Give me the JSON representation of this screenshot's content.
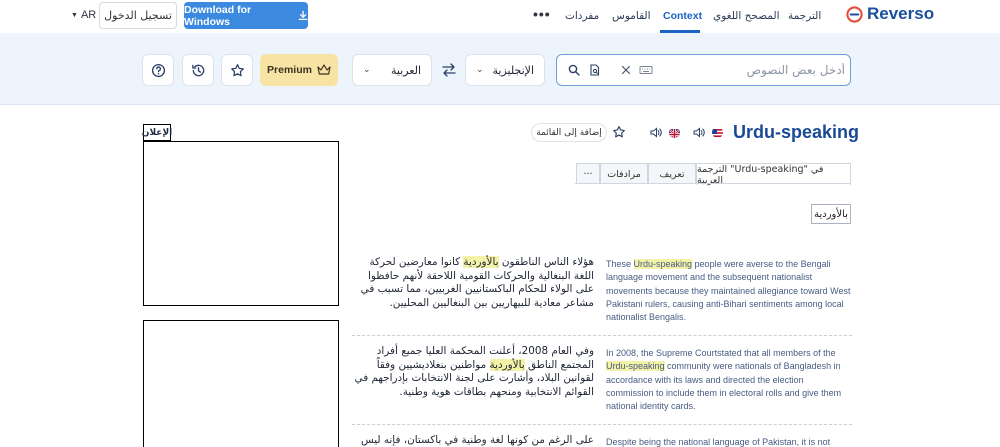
{
  "topnav": {
    "ui_lang": "AR",
    "login_label": "تسجيل الدخول",
    "download_label": "Download for Windows",
    "items": [
      "مفردات",
      "القاموس",
      "Context",
      "المصحح اللغوي",
      "الترجمة"
    ],
    "brand": "Reverso"
  },
  "search": {
    "placeholder": "أدخل بعض النصوص",
    "source_lang": "الإنجليزية",
    "target_lang": "العربية",
    "premium_label": "Premium"
  },
  "ad": {
    "label": "الإعلان"
  },
  "entry": {
    "title": "Urdu-speaking",
    "add_to_list": "إضافة إلى القائمة",
    "tabs": {
      "translation": "الترجمة \"Urdu-speaking\" في العربية",
      "definition": "تعريف",
      "synonyms": "مرادفات",
      "more": "···"
    },
    "pos_chip": "بالأوردية"
  },
  "examples": [
    {
      "en_before": "These ",
      "en_hl": "Urdu-speaking",
      "en_after": " people were averse to the Bengali language movement and the subsequent nationalist movements because they maintained allegiance toward West Pakistani rulers, causing anti-Bihari sentiments among local nationalist Bengalis.",
      "ar_before": "هؤلاء الناس الناطقون ",
      "ar_hl": "بالأوردية",
      "ar_after": " كانوا معارضين لحركة اللغة البنغالية والحركات القومية اللاحقة لأنهم حافظوا على الولاء للحكام الباكستانيين الغربيين، مما تسبب في مشاعر معادية للبيهاريين بين البنغاليين المحليين."
    },
    {
      "en_before": "In 2008, the Supreme Courtstated that all members of the ",
      "en_hl": "Urdu-speaking",
      "en_after": " community were nationals of Bangladesh in accordance with its laws and directed the election commission to include them in electoral rolls and give them national identity cards.",
      "ar_before": "وفي العام 2008، أعلنت المحكمة العليا جميع أفراد المجتمع الناطق ",
      "ar_hl": "بالأوردية",
      "ar_after": " مواطنين بنغلاديشيين وفقاً لقوانين البلاد، وأشارت على لجنة الانتخابات بإدراجهم في القوائم الانتخابية ومنحهم بطاقات هوية وطنية."
    },
    {
      "en_before": "Despite being the national language of Pakistan, it is not",
      "en_hl": "",
      "en_after": "",
      "ar_before": "على الرغم من كونها لغة وطنية في باكستان، فإنه ليس من",
      "ar_hl": "",
      "ar_after": ""
    }
  ],
  "colors": {
    "accent": "#1c63c4",
    "download": "#3b8ae0",
    "premium": "#f7e3a4",
    "band": "#eef4fb",
    "highlight": "#f3f2a6"
  }
}
